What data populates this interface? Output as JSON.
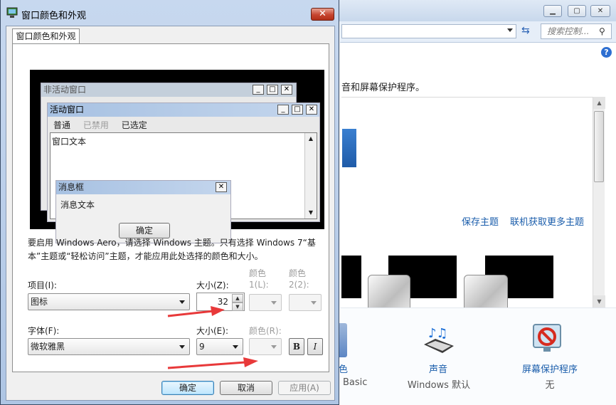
{
  "background_window": {
    "search_placeholder": "搜索控制...",
    "description": "音和屏幕保护程序。",
    "links": {
      "save_theme": "保存主题",
      "get_more_themes": "联机获取更多主题"
    },
    "bottom": {
      "basic_label": "色",
      "basic_sub": "Basic",
      "sound_label": "声音",
      "sound_sub": "Windows 默认",
      "screensaver_label": "屏幕保护程序",
      "screensaver_sub": "无"
    }
  },
  "dialog": {
    "title": "窗口颜色和外观",
    "tab_label": "窗口颜色和外观",
    "preview": {
      "inactive_title": "非活动窗口",
      "active_title": "活动窗口",
      "menu_normal": "普通",
      "menu_disabled": "已禁用",
      "menu_selected": "已选定",
      "window_text": "窗口文本",
      "msgbox_title": "消息框",
      "msgbox_text": "消息文本",
      "msgbox_ok": "确定"
    },
    "description": "要启用 Windows Aero，请选择 Windows 主题。只有选择 Windows 7“基本”主题或“轻松访问”主题，才能应用此处选择的颜色和大小。",
    "item_label": "项目(I):",
    "item_value": "图标",
    "size_label": "大小(Z):",
    "size_value": "32",
    "color1_label": "颜色 1(L):",
    "color2_label": "颜色 2(2):",
    "font_label": "字体(F):",
    "font_value": "微软雅黑",
    "font_size_label": "大小(E):",
    "font_size_value": "9",
    "font_color_label": "颜色(R):",
    "bold_label": "B",
    "italic_label": "I",
    "ok_button": "确定",
    "cancel_button": "取消",
    "apply_button": "应用(A)"
  },
  "colors": {
    "accent_arrow": "#e8393a",
    "link": "#1a5dab"
  }
}
